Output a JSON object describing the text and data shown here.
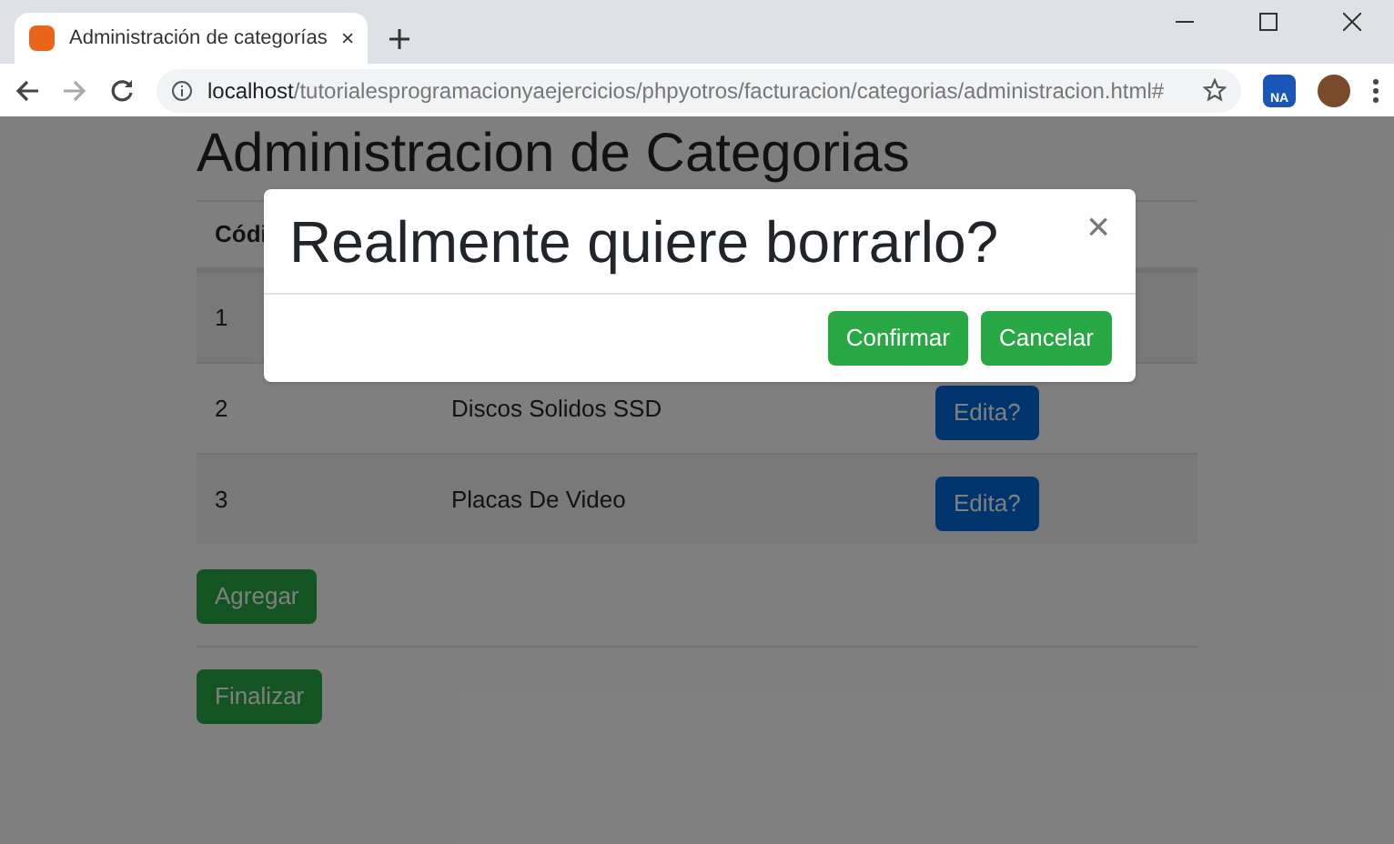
{
  "browser": {
    "tab_title": "Administración de categorías",
    "url_host": "localhost",
    "url_path": "/tutorialesprogramacionyaejercicios/phpyotros/facturacion/categorias/administracion.html#",
    "extension_badge": "NA"
  },
  "page": {
    "heading": "Administracion de Categorias",
    "table": {
      "columns": [
        "Códi"
      ],
      "rows": [
        {
          "code": "1"
        },
        {
          "code": "2",
          "name": "Discos Solidos SSD",
          "action": "Edita?"
        },
        {
          "code": "3",
          "name": "Placas De Video",
          "action": "Edita?"
        }
      ]
    },
    "buttons": [
      "Agregar",
      "Finalizar"
    ]
  },
  "modal": {
    "title": "Realmente quiere borrarlo?",
    "close": "×",
    "buttons": [
      "Confirmar",
      "Cancelar"
    ]
  }
}
